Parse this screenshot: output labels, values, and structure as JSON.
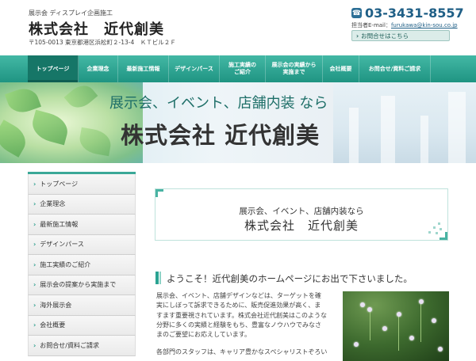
{
  "header": {
    "tagline": "展示会 ディスプレイ企画施工",
    "company": "株式会社　近代創美",
    "address": "〒105-0013 東京都港区浜松町２-13-4　ＫＴビル２Ｆ",
    "phone": "03-3431-8557",
    "email_label": "担当者E-mail：",
    "email": "furukawa@kin-sou.co.jp",
    "contact_button": "お問合せはこちら"
  },
  "nav": {
    "items": [
      {
        "label": "トップページ"
      },
      {
        "label": "企業理念"
      },
      {
        "label": "最新施工情報"
      },
      {
        "label": "デザインパース"
      },
      {
        "label": "施工実績の\nご紹介"
      },
      {
        "label": "展示会の実績から\n実施まで"
      },
      {
        "label": "会社概要"
      },
      {
        "label": "お問合せ/資料ご請求"
      }
    ]
  },
  "hero": {
    "line1": "展示会、イベント、店舗内装 なら",
    "line2": "株式会社 近代創美"
  },
  "sidebar": {
    "items": [
      {
        "label": "トップページ"
      },
      {
        "label": "企業理念"
      },
      {
        "label": "最新施工情報"
      },
      {
        "label": "デザインパース"
      },
      {
        "label": "施工実績のご紹介"
      },
      {
        "label": "展示会の提案から実施まで"
      },
      {
        "label": "海外展示会"
      },
      {
        "label": "会社概要"
      },
      {
        "label": "お問合せ/資料ご請求"
      }
    ]
  },
  "main": {
    "box_line1": "展示会、イベント、店舗内装なら",
    "box_line2": "株式会社　近代創美",
    "welcome": "ようこそ！近代創美のホームページにお出で下さいました。",
    "paragraph1": "展示会、イベント、店舗デザインなどは、ターゲットを確実にしぼって訴求できるために、販売促進効果が高く、ますます重要視されています。株式会社近代創美はこのような分野に多くの実績と経験をもち、豊富なノウハウでみなさまのご要望にお応えしています。",
    "paragraph2": "各部門のスタッフは、キャリア豊かなスペシャリストぞろい"
  },
  "chevron_glyph": "›",
  "phone_glyph": "☎",
  "colors": {
    "accent": "#2aa392",
    "nav": "#1f9482",
    "phone": "#1f5f86"
  }
}
